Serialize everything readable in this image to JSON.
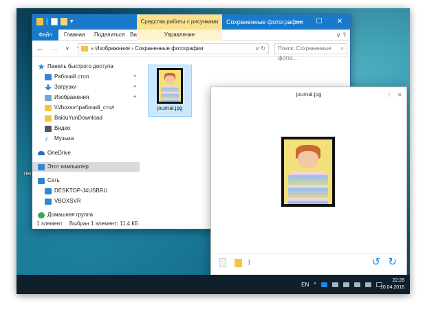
{
  "desktop": {
    "label": "текс"
  },
  "explorer": {
    "title": "Сохраненные фотографии",
    "context_tab": "Средства работы с рисунками",
    "window_buttons": [
      "—",
      "☐",
      "✕"
    ],
    "tabs": [
      "Файл",
      "Главная",
      "Поделиться",
      "Вид",
      "Управление"
    ],
    "ribbon_right": "∨ ?",
    "nav_arrows": [
      "←",
      "→",
      "∨",
      "↑"
    ],
    "address": "« Изображения › Сохраненные фотографии",
    "address_tail": "∨ ↻",
    "search_placeholder": "Поиск: Сохраненные фотог...",
    "search_icon": "⌕",
    "nav_items": [
      {
        "label": "Панель быстрого доступа",
        "icon": "star-icon",
        "color": "#2f86d6"
      },
      {
        "label": "Рабочий стол",
        "icon": "desktop-icon",
        "color": "#2f86d6",
        "pinned": true
      },
      {
        "label": "Загрузки",
        "icon": "download-icon",
        "color": "#2f86d6",
        "pinned": true
      },
      {
        "label": "Изображения",
        "icon": "pictures-icon",
        "color": "#7aa7c8",
        "pinned": true
      },
      {
        "label": "\\\\Vboxsvr\\рабочий_стол",
        "icon": "folder-icon",
        "color": "#f4c542"
      },
      {
        "label": "BaiduYunDownload",
        "icon": "folder-icon",
        "color": "#f4c542"
      },
      {
        "label": "Видео",
        "icon": "video-icon",
        "color": "#555555"
      },
      {
        "label": "Музыка",
        "icon": "music-icon",
        "color": "#2f86d6"
      },
      {
        "label": "OneDrive",
        "icon": "onedrive-icon",
        "color": "#1c6fc2"
      },
      {
        "label": "Этот компьютер",
        "icon": "computer-icon",
        "color": "#2f86d6",
        "selected": true
      },
      {
        "label": "Сеть",
        "icon": "network-icon",
        "color": "#2f86d6"
      },
      {
        "label": "DESKTOP-J4USBRU",
        "icon": "computer-icon",
        "color": "#2f86d6"
      },
      {
        "label": "VBOXSVR",
        "icon": "computer-icon",
        "color": "#2f86d6"
      },
      {
        "label": "Домашняя группа",
        "icon": "homegroup-icon",
        "color": "#3aa845"
      }
    ],
    "file": {
      "name": "journal.jpg"
    },
    "status": {
      "count": "1 элемент",
      "selected": "Выбран 1 элемент: 11,4 КБ"
    }
  },
  "viewer": {
    "title": "journal.jpg",
    "buttons": [
      "⁝",
      "✕"
    ],
    "cursor": "|",
    "rotate_left": "↺",
    "rotate_right": "↻"
  },
  "taskbar": {
    "lang": "EN",
    "chevron": "^",
    "time": "22:28",
    "date": "10.04.2016"
  }
}
